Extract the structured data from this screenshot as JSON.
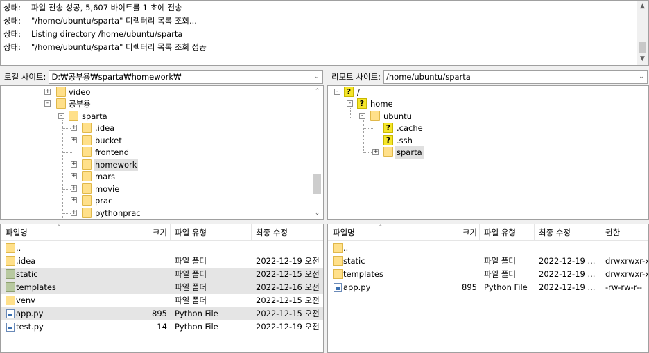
{
  "log": {
    "lines": [
      {
        "label": "상태:",
        "text": "파일 전송 성공, 5,607 바이트를 1 초에 전송"
      },
      {
        "label": "상태:",
        "text": "\"/home/ubuntu/sparta\" 디렉터리 목록 조회..."
      },
      {
        "label": "상태:",
        "text": "Listing directory /home/ubuntu/sparta"
      },
      {
        "label": "상태:",
        "text": "\"/home/ubuntu/sparta\" 디렉터리 목록 조회 성공"
      }
    ]
  },
  "local": {
    "site_label": "로컬 사이트:",
    "path": "D:₩공부용₩sparta₩homework₩",
    "tree": [
      {
        "name": "video",
        "expander": "+"
      },
      {
        "name": "공부용",
        "expander": "-"
      },
      {
        "name": "sparta",
        "expander": "-"
      },
      {
        "name": ".idea",
        "expander": "+"
      },
      {
        "name": "bucket",
        "expander": "+"
      },
      {
        "name": "frontend",
        "expander": ""
      },
      {
        "name": "homework",
        "expander": "+",
        "selected": true
      },
      {
        "name": "mars",
        "expander": "+"
      },
      {
        "name": "movie",
        "expander": "+"
      },
      {
        "name": "prac",
        "expander": "+"
      },
      {
        "name": "pythonprac",
        "expander": "+"
      }
    ],
    "columns": {
      "name": "파일명",
      "size": "크기",
      "type": "파일 유형",
      "modified": "최종 수정"
    },
    "files": [
      {
        "name": "..",
        "size": "",
        "type": "",
        "modified": "",
        "icon": "folder"
      },
      {
        "name": ".idea",
        "size": "",
        "type": "파일 폴더",
        "modified": "2022-12-19 오전",
        "icon": "folder"
      },
      {
        "name": "static",
        "size": "",
        "type": "파일 폴더",
        "modified": "2022-12-15 오전",
        "icon": "folder-green",
        "highlight": true
      },
      {
        "name": "templates",
        "size": "",
        "type": "파일 폴더",
        "modified": "2022-12-16 오전",
        "icon": "folder-green",
        "highlight": true
      },
      {
        "name": "venv",
        "size": "",
        "type": "파일 폴더",
        "modified": "2022-12-15 오전",
        "icon": "folder"
      },
      {
        "name": "app.py",
        "size": "895",
        "type": "Python File",
        "modified": "2022-12-15 오전",
        "icon": "file",
        "highlight": true
      },
      {
        "name": "test.py",
        "size": "14",
        "type": "Python File",
        "modified": "2022-12-19 오전",
        "icon": "file"
      }
    ]
  },
  "remote": {
    "site_label": "리모트 사이트:",
    "path": "/home/ubuntu/sparta",
    "tree": [
      {
        "name": "/",
        "expander": "-",
        "icon": "question"
      },
      {
        "name": "home",
        "expander": "-",
        "icon": "question"
      },
      {
        "name": "ubuntu",
        "expander": "-",
        "icon": "folder"
      },
      {
        "name": ".cache",
        "expander": "",
        "icon": "question"
      },
      {
        "name": ".ssh",
        "expander": "",
        "icon": "question"
      },
      {
        "name": "sparta",
        "expander": "+",
        "icon": "folder",
        "selected": true
      }
    ],
    "columns": {
      "name": "파일명",
      "size": "크기",
      "type": "파일 유형",
      "modified": "최종 수정",
      "perms": "권한"
    },
    "files": [
      {
        "name": "..",
        "size": "",
        "type": "",
        "modified": "",
        "perms": "",
        "icon": "folder"
      },
      {
        "name": "static",
        "size": "",
        "type": "파일 폴더",
        "modified": "2022-12-19 ...",
        "perms": "drwxrwxr-x",
        "icon": "folder"
      },
      {
        "name": "templates",
        "size": "",
        "type": "파일 폴더",
        "modified": "2022-12-19 ...",
        "perms": "drwxrwxr-x",
        "icon": "folder"
      },
      {
        "name": "app.py",
        "size": "895",
        "type": "Python File",
        "modified": "2022-12-19 ...",
        "perms": "-rw-rw-r--",
        "icon": "file"
      }
    ]
  }
}
